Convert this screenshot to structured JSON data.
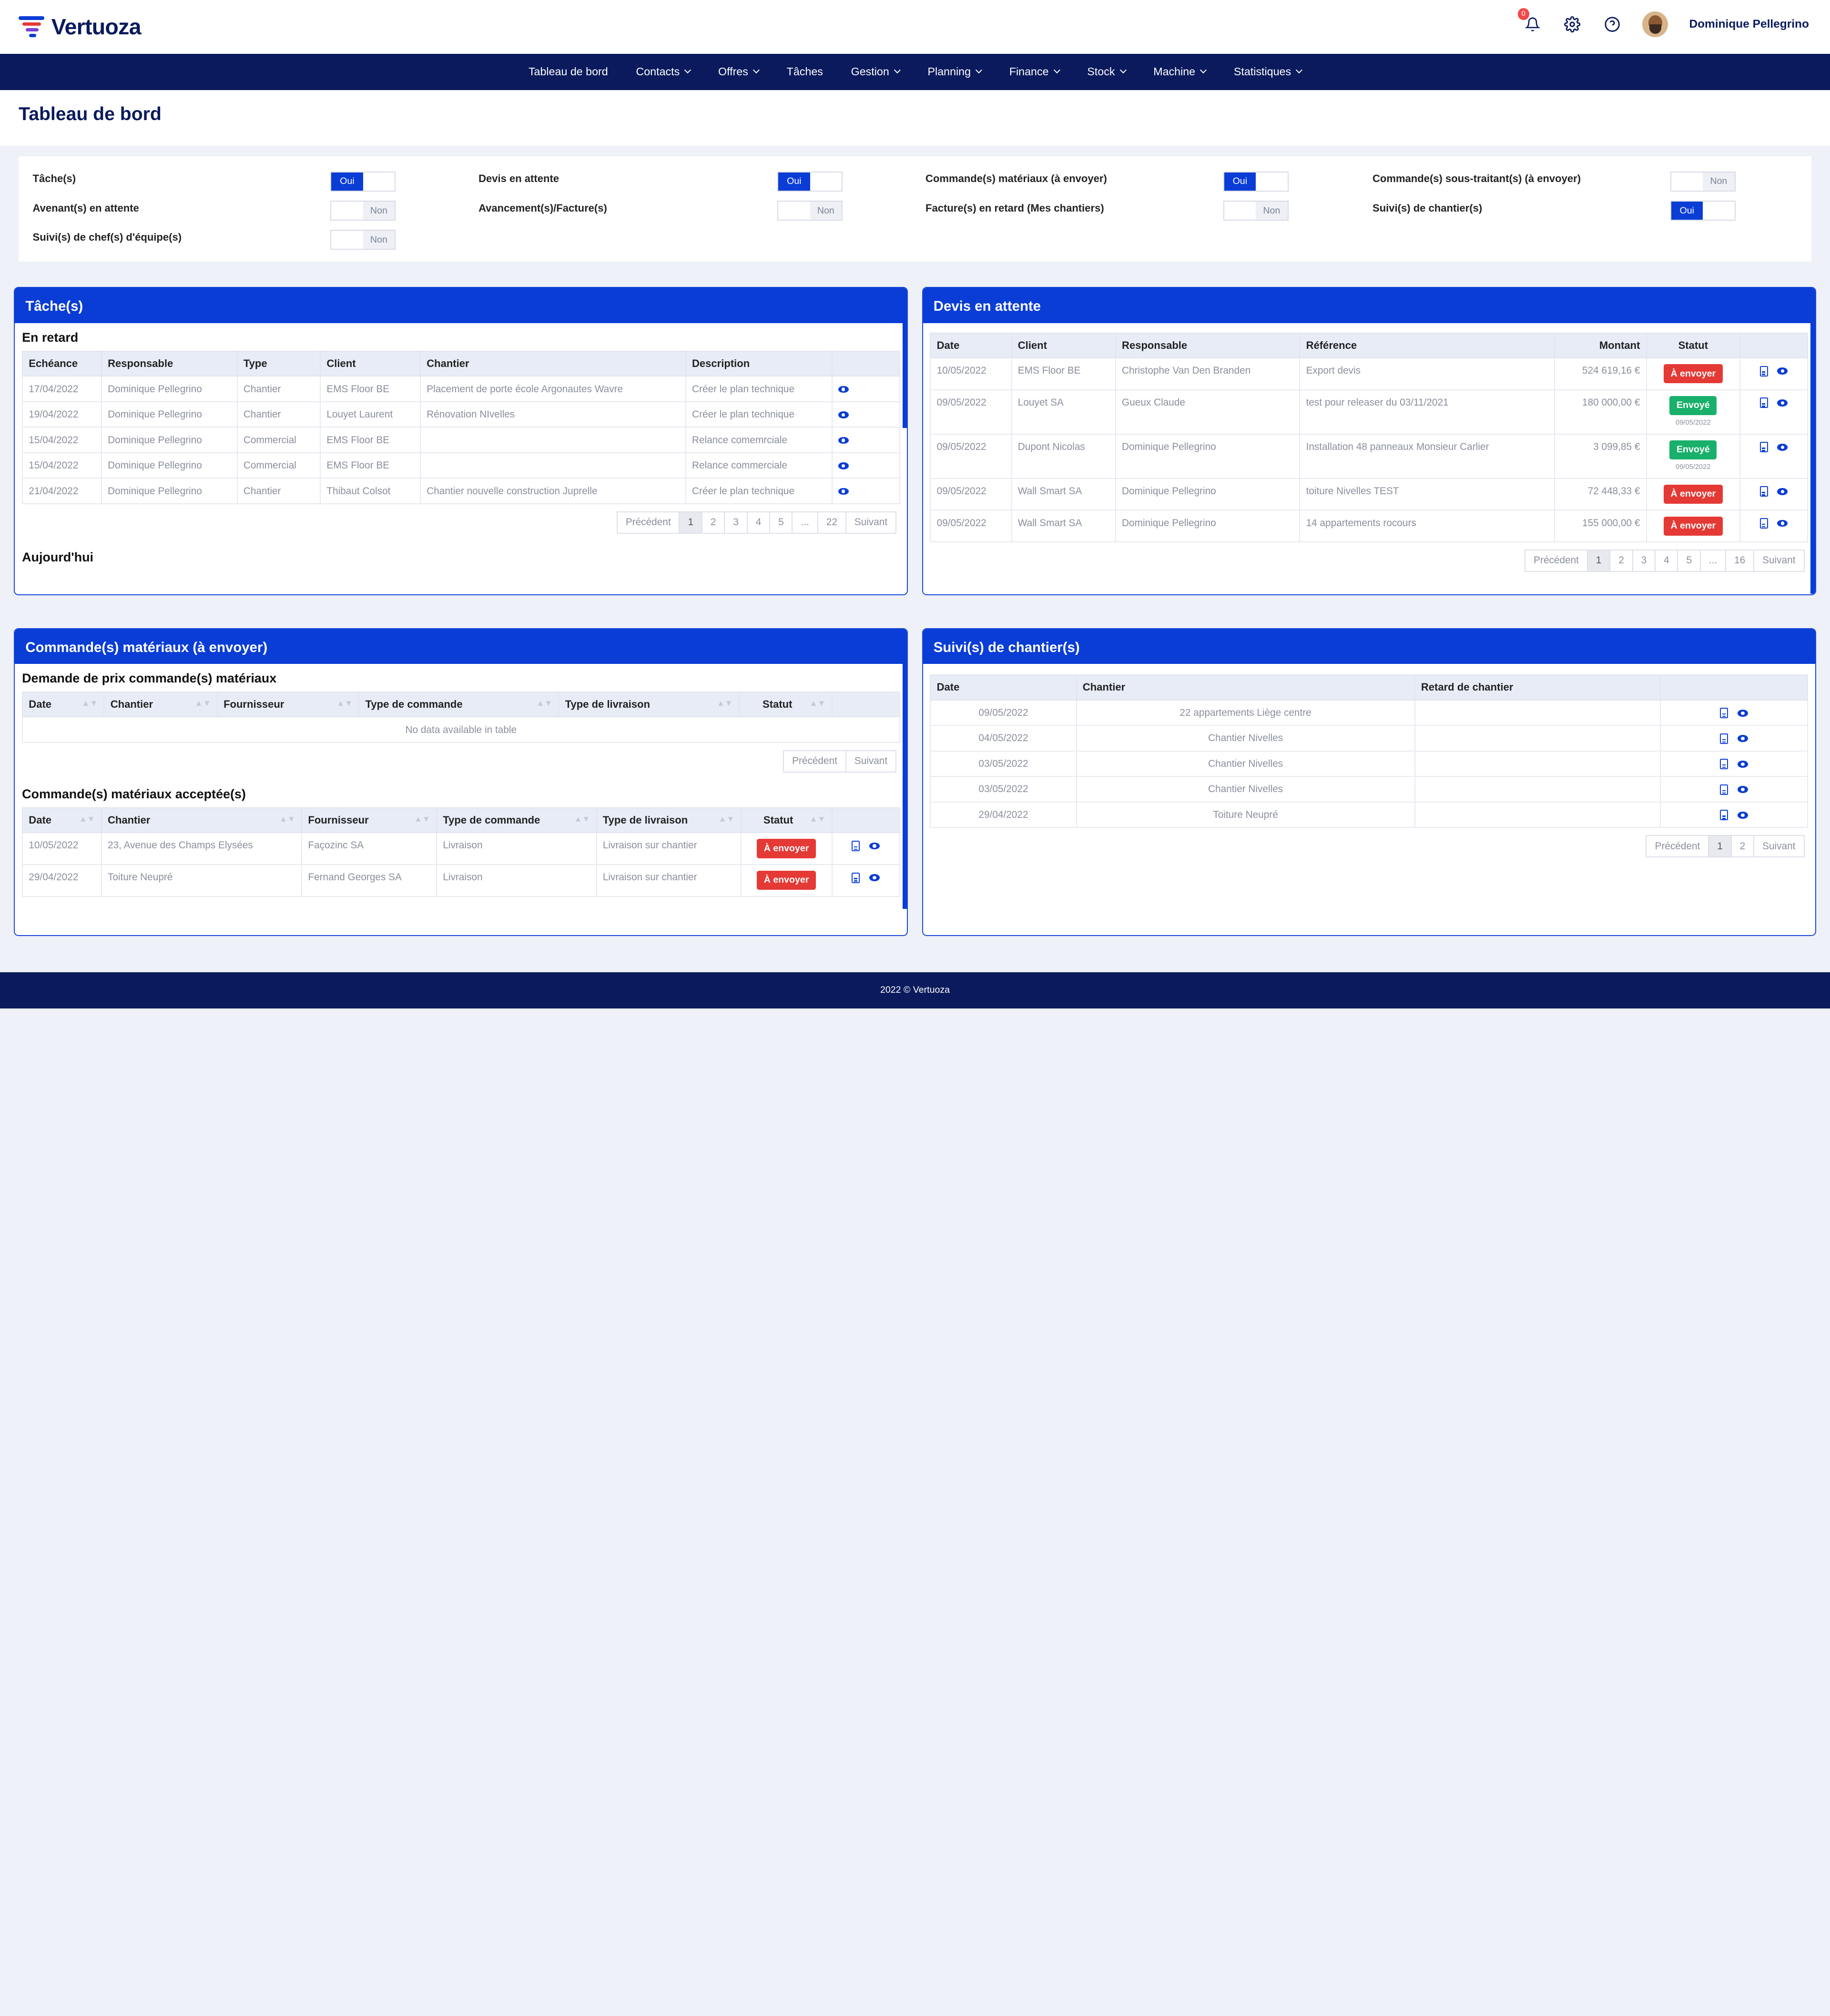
{
  "brand": {
    "name": "Vertuoza"
  },
  "header": {
    "notif_count": "0",
    "user_name": "Dominique Pellegrino"
  },
  "nav": {
    "items": [
      {
        "label": "Tableau de bord",
        "dropdown": false
      },
      {
        "label": "Contacts",
        "dropdown": true
      },
      {
        "label": "Offres",
        "dropdown": true
      },
      {
        "label": "Tâches",
        "dropdown": false
      },
      {
        "label": "Gestion",
        "dropdown": true
      },
      {
        "label": "Planning",
        "dropdown": true
      },
      {
        "label": "Finance",
        "dropdown": true
      },
      {
        "label": "Stock",
        "dropdown": true
      },
      {
        "label": "Machine",
        "dropdown": true
      },
      {
        "label": "Statistiques",
        "dropdown": true
      }
    ]
  },
  "page": {
    "title": "Tableau de bord"
  },
  "toggles": {
    "on_label": "Oui",
    "off_label": "Non",
    "items": [
      {
        "label": "Tâche(s)",
        "value": "Oui"
      },
      {
        "label": "Devis en attente",
        "value": "Oui"
      },
      {
        "label": "Commande(s) matériaux (à envoyer)",
        "value": "Oui"
      },
      {
        "label": "Commande(s) sous-traitant(s) (à envoyer)",
        "value": "Non"
      },
      {
        "label": "Avenant(s) en attente",
        "value": "Non"
      },
      {
        "label": "Avancement(s)/Facture(s)",
        "value": "Non"
      },
      {
        "label": "Facture(s) en retard (Mes chantiers)",
        "value": "Non"
      },
      {
        "label": "Suivi(s) de chantier(s)",
        "value": "Oui"
      },
      {
        "label": "Suivi(s) de chef(s) d'équipe(s)",
        "value": "Non"
      }
    ]
  },
  "taches": {
    "title": "Tâche(s)",
    "section": "En retard",
    "section2": "Aujourd'hui",
    "columns": [
      "Echéance",
      "Responsable",
      "Type",
      "Client",
      "Chantier",
      "Description"
    ],
    "rows": [
      [
        "17/04/2022",
        "Dominique Pellegrino",
        "Chantier",
        "EMS Floor BE",
        "Placement de porte école Argonautes Wavre",
        "Créer le plan technique"
      ],
      [
        "19/04/2022",
        "Dominique Pellegrino",
        "Chantier",
        "Louyet Laurent",
        "Rénovation NIvelles",
        "Créer le plan technique"
      ],
      [
        "15/04/2022",
        "Dominique Pellegrino",
        "Commercial",
        "EMS Floor BE",
        "",
        "Relance comemrciale"
      ],
      [
        "15/04/2022",
        "Dominique Pellegrino",
        "Commercial",
        "EMS Floor BE",
        "",
        "Relance commerciale"
      ],
      [
        "21/04/2022",
        "Dominique Pellegrino",
        "Chantier",
        "Thibaut Colsot",
        "Chantier nouvelle construction Juprelle",
        "Créer le plan technique"
      ]
    ],
    "pagination": [
      "Précédent",
      "1",
      "2",
      "3",
      "4",
      "5",
      "...",
      "22",
      "Suivant"
    ]
  },
  "devis": {
    "title": "Devis en attente",
    "columns": [
      "Date",
      "Client",
      "Responsable",
      "Référence",
      "Montant",
      "Statut"
    ],
    "rows": [
      {
        "date": "10/05/2022",
        "client": "EMS Floor BE",
        "resp": "Christophe Van Den Branden",
        "ref": "Export devis",
        "montant": "524 619,16 €",
        "statut": "À envoyer",
        "color": "red",
        "sub": ""
      },
      {
        "date": "09/05/2022",
        "client": "Louyet SA",
        "resp": "Gueux Claude",
        "ref": "test pour releaser du 03/11/2021",
        "montant": "180 000,00 €",
        "statut": "Envoyé",
        "color": "green",
        "sub": "09/05/2022"
      },
      {
        "date": "09/05/2022",
        "client": "Dupont Nicolas",
        "resp": "Dominique Pellegrino",
        "ref": "Installation 48 panneaux Monsieur Carlier",
        "montant": "3 099,85 €",
        "statut": "Envoyé",
        "color": "green",
        "sub": "09/05/2022"
      },
      {
        "date": "09/05/2022",
        "client": "Wall Smart SA",
        "resp": "Dominique Pellegrino",
        "ref": "toiture Nivelles TEST",
        "montant": "72 448,33 €",
        "statut": "À envoyer",
        "color": "red",
        "sub": ""
      },
      {
        "date": "09/05/2022",
        "client": "Wall Smart SA",
        "resp": "Dominique Pellegrino",
        "ref": "14 appartements rocours",
        "montant": "155 000,00 €",
        "statut": "À envoyer",
        "color": "red",
        "sub": ""
      }
    ],
    "pagination": [
      "Précédent",
      "1",
      "2",
      "3",
      "4",
      "5",
      "...",
      "16",
      "Suivant"
    ]
  },
  "commandes": {
    "title": "Commande(s) matériaux (à envoyer)",
    "section1": "Demande de prix commande(s) matériaux",
    "columns1": [
      "Date",
      "Chantier",
      "Fournisseur",
      "Type de commande",
      "Type de livraison",
      "Statut"
    ],
    "nodata": "No data available in table",
    "pagination1": [
      "Précédent",
      "Suivant"
    ],
    "section2": "Commande(s) matériaux acceptée(s)",
    "columns2": [
      "Date",
      "Chantier",
      "Fournisseur",
      "Type de commande",
      "Type de livraison",
      "Statut"
    ],
    "rows2": [
      [
        "10/05/2022",
        "23, Avenue des Champs Elysées",
        "Façozinc SA",
        "Livraison",
        "Livraison sur chantier",
        "À envoyer"
      ],
      [
        "29/04/2022",
        "Toiture Neupré",
        "Fernand Georges SA",
        "Livraison",
        "Livraison sur chantier",
        "À envoyer"
      ]
    ]
  },
  "suivis": {
    "title": "Suivi(s) de chantier(s)",
    "columns": [
      "Date",
      "Chantier",
      "Retard de chantier"
    ],
    "rows": [
      [
        "09/05/2022",
        "22 appartements Liège centre",
        ""
      ],
      [
        "04/05/2022",
        "Chantier Nivelles",
        ""
      ],
      [
        "03/05/2022",
        "Chantier Nivelles",
        ""
      ],
      [
        "03/05/2022",
        "Chantier Nivelles",
        ""
      ],
      [
        "29/04/2022",
        "Toiture Neupré",
        ""
      ]
    ],
    "pagination": [
      "Précédent",
      "1",
      "2",
      "Suivant"
    ]
  },
  "footer": {
    "text": "2022 © Vertuoza"
  },
  "colors": {
    "primary": "#0a3dd6",
    "navy": "#0a1a5c",
    "danger": "#e53935",
    "success": "#18b06a"
  }
}
